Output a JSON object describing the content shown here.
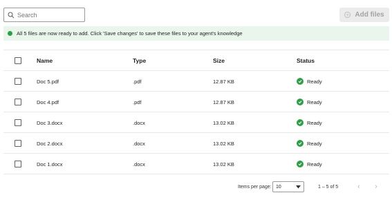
{
  "search": {
    "placeholder": "Search",
    "value": ""
  },
  "add_files": {
    "label": "Add files",
    "icon": "plus-circle-icon"
  },
  "banner": {
    "message": "All 5 files are now ready to add. Click 'Save changes' to save these files to your agent's knowledge",
    "color": "#2e9e47"
  },
  "table": {
    "headers": {
      "name": "Name",
      "type": "Type",
      "size": "Size",
      "status": "Status"
    },
    "rows": [
      {
        "name": "Doc 5.pdf",
        "type": ".pdf",
        "size": "12.87 KB",
        "status": "Ready"
      },
      {
        "name": "Doc 4.pdf",
        "type": ".pdf",
        "size": "12.87 KB",
        "status": "Ready"
      },
      {
        "name": "Doc 3.docx",
        "type": ".docx",
        "size": "13.02 KB",
        "status": "Ready"
      },
      {
        "name": "Doc 2.docx",
        "type": ".docx",
        "size": "13.02 KB",
        "status": "Ready"
      },
      {
        "name": "Doc 1.docx",
        "type": ".docx",
        "size": "13.02 KB",
        "status": "Ready"
      }
    ]
  },
  "pagination": {
    "items_per_page_label": "Items per page:",
    "items_per_page": "10",
    "range": "1 – 5 of 5"
  }
}
